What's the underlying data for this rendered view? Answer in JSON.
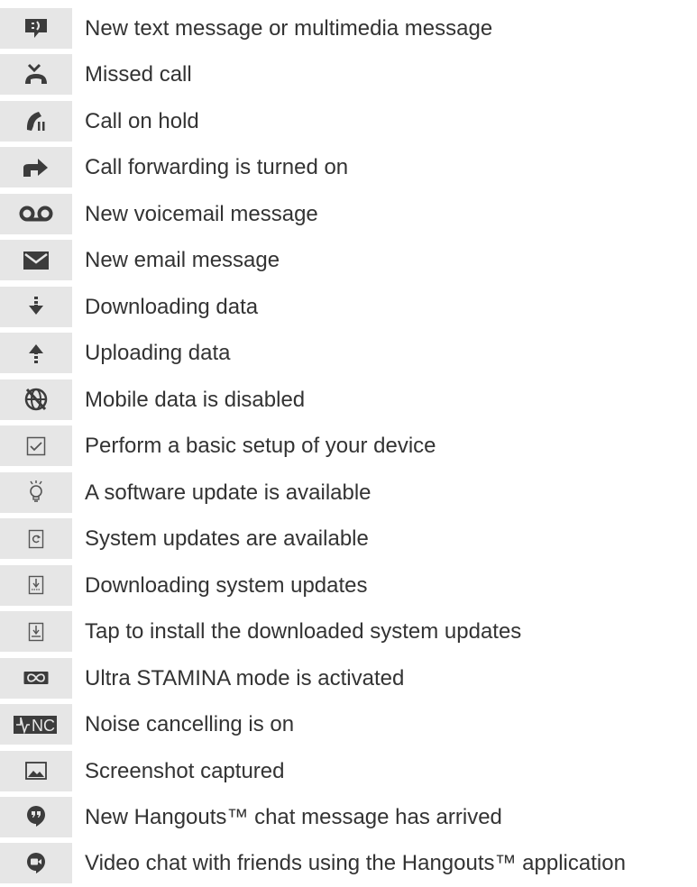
{
  "items": [
    {
      "icon": "text-message-icon",
      "label": "New text message or multimedia message"
    },
    {
      "icon": "missed-call-icon",
      "label": "Missed call"
    },
    {
      "icon": "call-on-hold-icon",
      "label": "Call on hold"
    },
    {
      "icon": "call-forwarding-icon",
      "label": "Call forwarding is turned on"
    },
    {
      "icon": "voicemail-icon",
      "label": "New voicemail message"
    },
    {
      "icon": "email-icon",
      "label": "New email message"
    },
    {
      "icon": "download-icon",
      "label": "Downloading data"
    },
    {
      "icon": "upload-icon",
      "label": "Uploading data"
    },
    {
      "icon": "mobile-data-disabled-icon",
      "label": "Mobile data is disabled"
    },
    {
      "icon": "setup-checkbox-icon",
      "label": "Perform a basic setup of your device"
    },
    {
      "icon": "lightbulb-icon",
      "label": "A software update is available"
    },
    {
      "icon": "system-update-icon",
      "label": "System updates are available"
    },
    {
      "icon": "downloading-system-update-icon",
      "label": "Downloading system updates"
    },
    {
      "icon": "install-update-icon",
      "label": "Tap to install the downloaded system updates"
    },
    {
      "icon": "ultra-stamina-icon",
      "label": "Ultra STAMINA mode is activated"
    },
    {
      "icon": "noise-cancelling-icon",
      "label": "Noise cancelling is on",
      "icon_text": "NC"
    },
    {
      "icon": "screenshot-icon",
      "label": "Screenshot captured"
    },
    {
      "icon": "hangouts-chat-icon",
      "label": "New Hangouts™ chat message has arrived"
    },
    {
      "icon": "hangouts-video-icon",
      "label": "Video chat with friends using the Hangouts™ application"
    }
  ]
}
